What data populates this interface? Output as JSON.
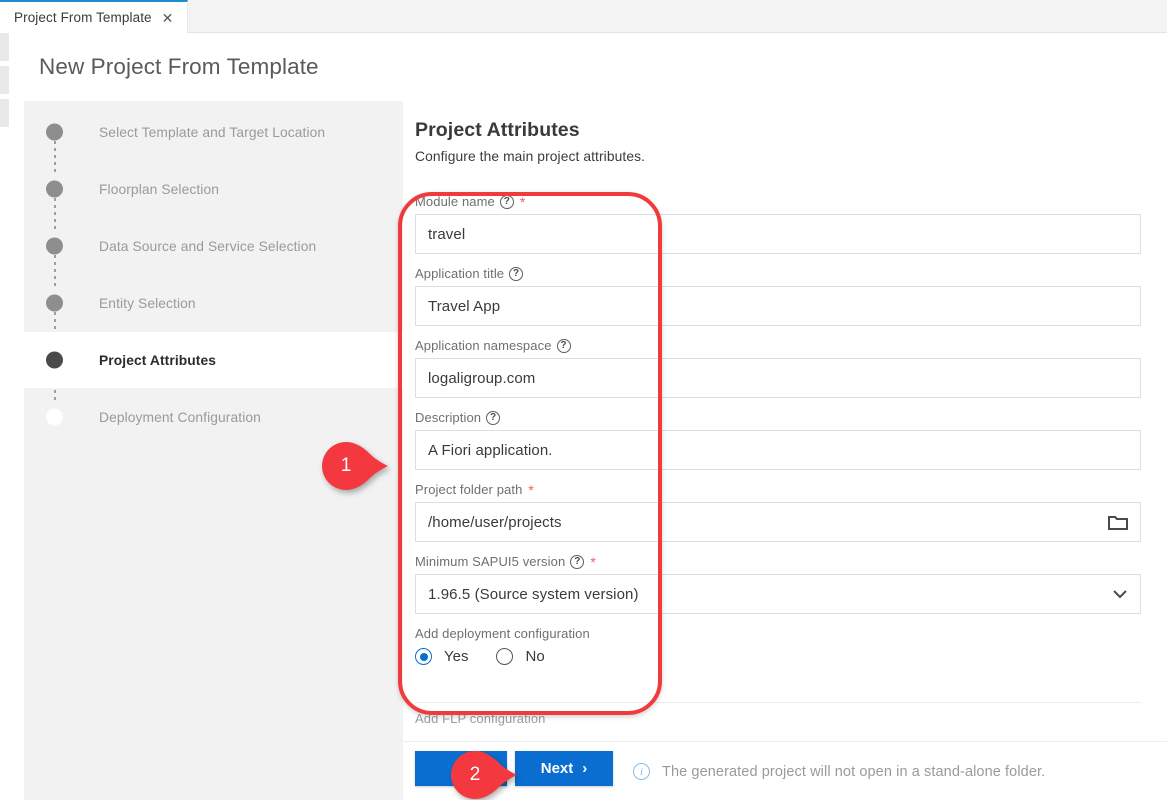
{
  "tab": {
    "label": "Project From Template",
    "close_icon": "close-icon"
  },
  "page": {
    "title": "New Project From Template"
  },
  "wizard": {
    "steps": [
      {
        "label": "Select Template and Target Location",
        "state": "done"
      },
      {
        "label": "Floorplan Selection",
        "state": "done"
      },
      {
        "label": "Data Source and Service Selection",
        "state": "done"
      },
      {
        "label": "Entity Selection",
        "state": "done"
      },
      {
        "label": "Project Attributes",
        "state": "current"
      },
      {
        "label": "Deployment Configuration",
        "state": "pending"
      }
    ]
  },
  "section": {
    "title": "Project Attributes",
    "subtitle": "Configure the main project attributes."
  },
  "form": {
    "fields": [
      {
        "label": "Module name",
        "help": true,
        "required": true,
        "value": "travel",
        "icon": null
      },
      {
        "label": "Application title",
        "help": true,
        "required": false,
        "value": "Travel App",
        "icon": null
      },
      {
        "label": "Application namespace",
        "help": true,
        "required": false,
        "value": "logaligroup.com",
        "icon": null
      },
      {
        "label": "Description",
        "help": true,
        "required": false,
        "value": "A Fiori application.",
        "icon": null
      },
      {
        "label": "Project folder path",
        "help": false,
        "required": true,
        "value": "/home/user/projects",
        "icon": "folder-icon"
      },
      {
        "label": "Minimum SAPUI5 version",
        "help": true,
        "required": true,
        "value": "1.96.5 (Source system version)",
        "icon": "chevron-down-icon"
      }
    ],
    "deployment": {
      "label": "Add deployment configuration",
      "options": [
        {
          "label": "Yes",
          "selected": true
        },
        {
          "label": "No",
          "selected": false
        }
      ]
    },
    "cut_off_label": "Add FLP configuration"
  },
  "footer": {
    "back_label": "",
    "back_icon": "chevron-left-icon",
    "next_label": "Next",
    "next_icon": "chevron-right-icon",
    "info_icon": "info-icon",
    "hint": "The generated project will not open in a stand-alone folder."
  },
  "annotations": {
    "badges": [
      {
        "number": "1"
      },
      {
        "number": "2"
      }
    ],
    "accent_color": "#ef3b3b"
  },
  "colors": {
    "primary_blue": "#0a6ed1",
    "tab_accent": "#1f8cd0",
    "annotation_red": "#ef3b3b",
    "sidebar_bg": "#f2f2f2"
  }
}
